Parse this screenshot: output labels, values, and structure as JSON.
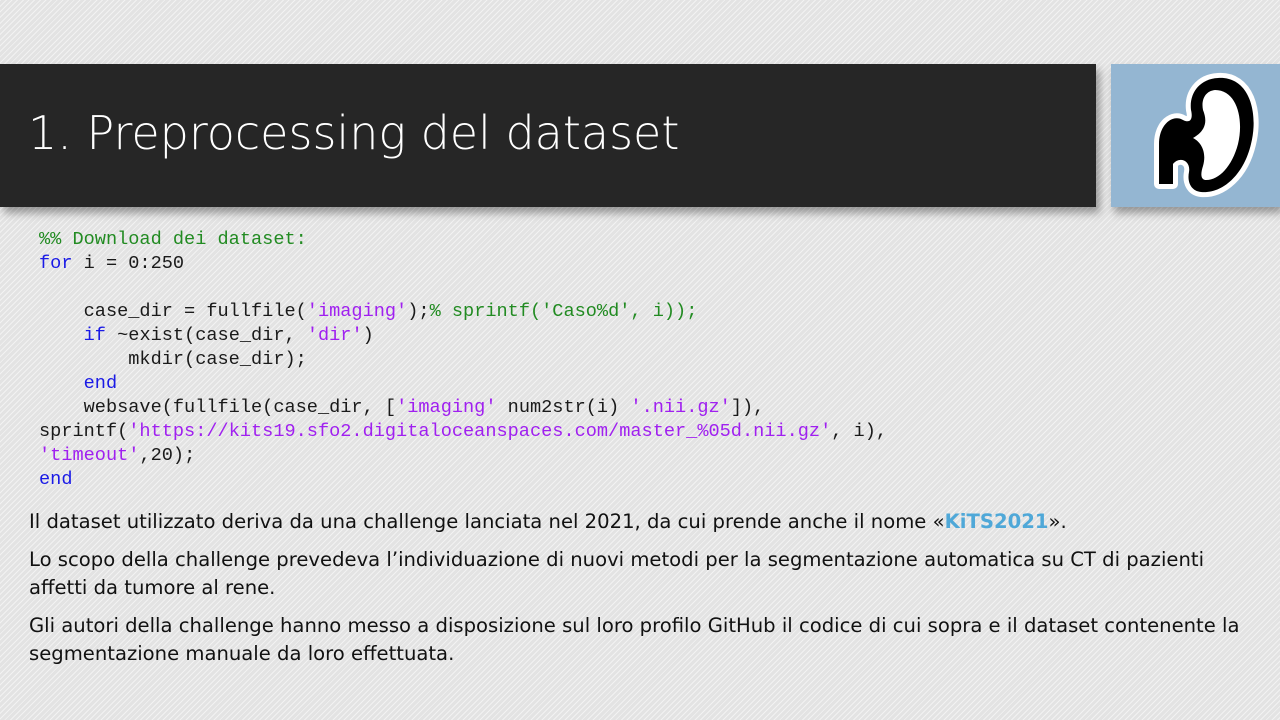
{
  "slide": {
    "title": "1. Preprocessing del dataset"
  },
  "logo": {
    "icon": "kidney-icon",
    "background": "#94b6d2"
  },
  "code": {
    "language": "MATLAB",
    "lines": [
      [
        {
          "t": "%% Download dei dataset:",
          "c": "comment"
        }
      ],
      [
        {
          "t": "for",
          "c": "kw"
        },
        {
          "t": " i = 0:250",
          "c": "plain"
        }
      ],
      [],
      [
        {
          "t": "    case_dir = fullfile(",
          "c": "plain"
        },
        {
          "t": "'imaging'",
          "c": "str"
        },
        {
          "t": ");",
          "c": "plain"
        },
        {
          "t": "% sprintf('Caso%d', i));",
          "c": "comment"
        }
      ],
      [
        {
          "t": "    ",
          "c": "plain"
        },
        {
          "t": "if",
          "c": "kw"
        },
        {
          "t": " ~exist(case_dir, ",
          "c": "plain"
        },
        {
          "t": "'dir'",
          "c": "str"
        },
        {
          "t": ")",
          "c": "plain"
        }
      ],
      [
        {
          "t": "        mkdir(case_dir);",
          "c": "plain"
        }
      ],
      [
        {
          "t": "    ",
          "c": "plain"
        },
        {
          "t": "end",
          "c": "kw"
        }
      ],
      [
        {
          "t": "    websave(fullfile(case_dir, [",
          "c": "plain"
        },
        {
          "t": "'imaging'",
          "c": "str"
        },
        {
          "t": " num2str(i) ",
          "c": "plain"
        },
        {
          "t": "'.nii.gz'",
          "c": "str"
        },
        {
          "t": "]),",
          "c": "plain"
        }
      ],
      [
        {
          "t": "sprintf(",
          "c": "plain"
        },
        {
          "t": "'https://kits19.sfo2.digitaloceanspaces.com/master_%05d.nii.gz'",
          "c": "str"
        },
        {
          "t": ", i),",
          "c": "plain"
        }
      ],
      [
        {
          "t": "'timeout'",
          "c": "str"
        },
        {
          "t": ",20);",
          "c": "plain"
        }
      ],
      [
        {
          "t": "end",
          "c": "kw"
        }
      ]
    ]
  },
  "paragraphs": {
    "p1_before": "Il dataset utilizzato deriva da una challenge lanciata nel 2021, da cui prende anche il nome «",
    "p1_highlight": "KiTS2021",
    "p1_after": "».",
    "p2": "Lo scopo della challenge prevedeva l’individuazione di nuovi metodi per la segmentazione automatica su CT di pazienti affetti da tumore al rene.",
    "p3": "Gli autori della challenge hanno messo a disposizione sul loro profilo GitHub il codice di cui sopra e il dataset contenente la segmentazione manuale da loro effettuata."
  },
  "colors": {
    "title_bar": "#262626",
    "highlight": "#4fa8d8",
    "code_comment": "#228b22",
    "code_keyword": "#1a1ae6",
    "code_string": "#a020f0"
  }
}
